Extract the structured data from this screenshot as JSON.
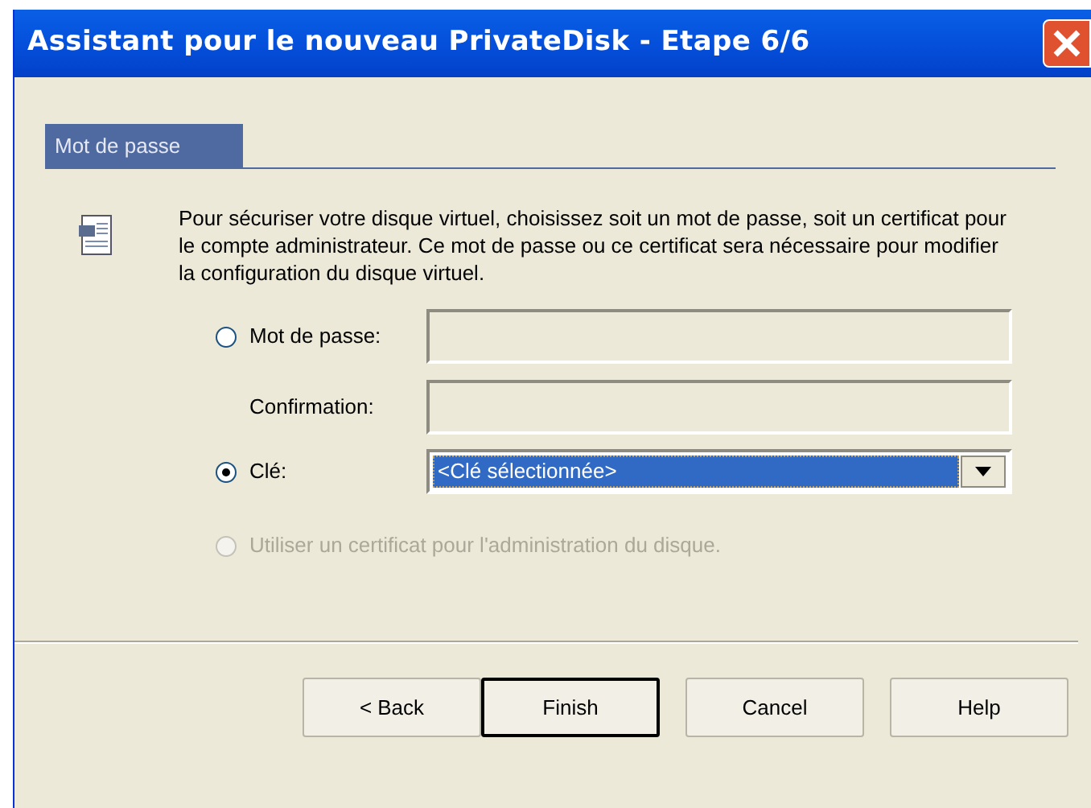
{
  "window": {
    "title": "Assistant pour le nouveau PrivateDisk - Etape 6/6"
  },
  "section": {
    "title": "Mot de passe"
  },
  "description": "Pour sécuriser votre disque virtuel, choisissez soit un mot de passe, soit un certificat pour le compte administrateur. Ce mot de passe ou ce certificat sera nécessaire pour modifier la configuration du disque virtuel.",
  "options": [
    {
      "kind": "password",
      "label": "Mot de passe:",
      "selected": false,
      "disabled": false,
      "confirm_label": "Confirmation:"
    },
    {
      "kind": "combo",
      "label": "Clé:",
      "selected": true,
      "disabled": false,
      "value": "<Clé sélectionnée>"
    },
    {
      "kind": "plain",
      "label": "Utiliser un certificat pour l'administration du disque.",
      "selected": false,
      "disabled": true
    }
  ],
  "buttons": [
    {
      "label": "< Back",
      "default": false
    },
    {
      "label": "Finish",
      "default": true
    },
    {
      "label": "Cancel",
      "default": false
    },
    {
      "label": "Help",
      "default": false
    }
  ]
}
